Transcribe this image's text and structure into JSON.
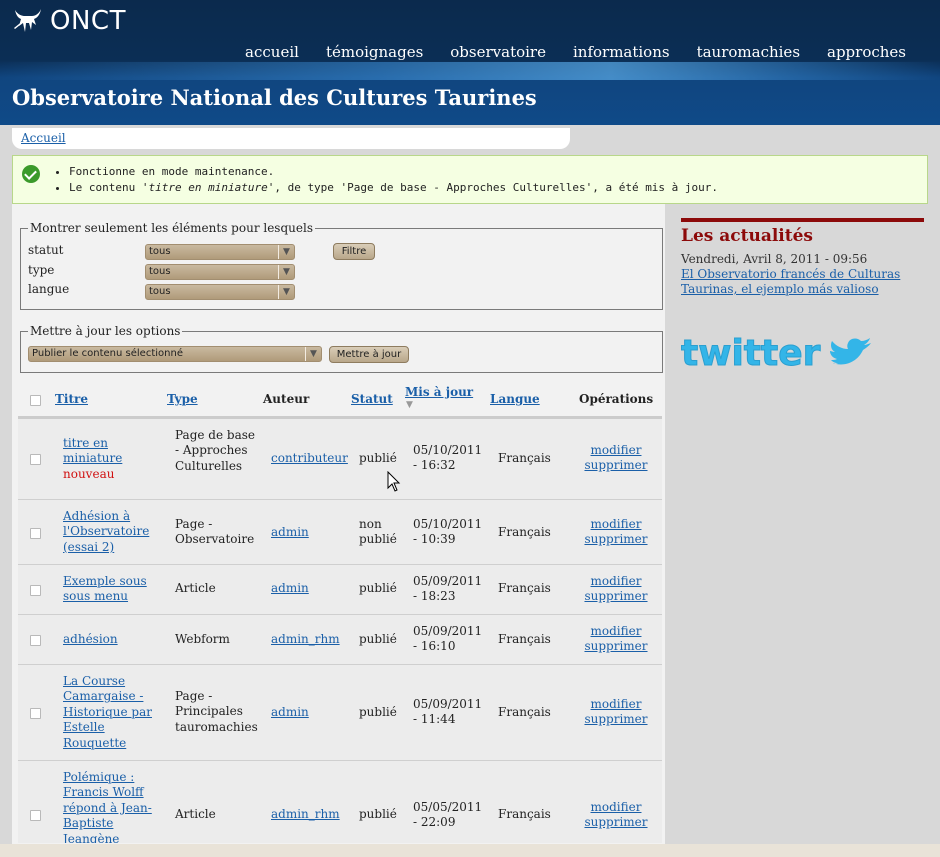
{
  "header": {
    "logo_text": "ONCT",
    "site_title": "Observatoire National des Cultures Taurines",
    "nav": [
      "accueil",
      "témoignages",
      "observatoire",
      "informations",
      "tauromachies",
      "approches"
    ]
  },
  "breadcrumb": {
    "home": "Accueil"
  },
  "messages": {
    "line1": "Fonctionne en mode maintenance.",
    "line2_pre": "Le contenu '",
    "line2_title": "titre en miniature",
    "line2_post": "', de type 'Page de base - Approches Culturelles', a été mis à jour."
  },
  "filter": {
    "legend": "Montrer seulement les éléments pour lesquels",
    "status_label": "statut",
    "type_label": "type",
    "lang_label": "langue",
    "status_value": "tous",
    "type_value": "tous",
    "lang_value": "tous",
    "button": "Filtre"
  },
  "update": {
    "legend": "Mettre à jour les options",
    "select_value": "Publier le contenu sélectionné",
    "button": "Mettre à jour"
  },
  "table": {
    "headers": {
      "title": "Titre",
      "type": "Type",
      "author": "Auteur",
      "status": "Statut",
      "updated": "Mis à jour",
      "lang": "Langue",
      "ops": "Opérations"
    },
    "rows": [
      {
        "title": "titre en miniature",
        "badge": "nouveau",
        "type": "Page de base - Approches Culturelles",
        "author": "contributeur",
        "status": "publié",
        "updated": "05/10/2011 - 16:32",
        "lang": "Français",
        "edit": "modifier",
        "delete": "supprimer"
      },
      {
        "title": "Adhésion à l'Observatoire (essai 2)",
        "badge": "",
        "type": "Page - Observatoire",
        "author": "admin",
        "status": "non publié",
        "updated": "05/10/2011 - 10:39",
        "lang": "Français",
        "edit": "modifier",
        "delete": "supprimer"
      },
      {
        "title": "Exemple sous sous menu",
        "badge": "",
        "type": "Article",
        "author": "admin",
        "status": "publié",
        "updated": "05/09/2011 - 18:23",
        "lang": "Français",
        "edit": "modifier",
        "delete": "supprimer"
      },
      {
        "title": "adhésion",
        "badge": "",
        "type": "Webform",
        "author": "admin_rhm",
        "status": "publié",
        "updated": "05/09/2011 - 16:10",
        "lang": "Français",
        "edit": "modifier",
        "delete": "supprimer"
      },
      {
        "title": "La Course Camargaise - Historique par Estelle Rouquette",
        "badge": "",
        "type": "Page - Principales tauromachies",
        "author": "admin",
        "status": "publié",
        "updated": "05/09/2011 - 11:44",
        "lang": "Français",
        "edit": "modifier",
        "delete": "supprimer"
      },
      {
        "title": "Polémique : Francis Wolff répond à Jean-Baptiste Jeangène",
        "badge": "",
        "type": "Article",
        "author": "admin_rhm",
        "status": "publié",
        "updated": "05/05/2011 - 22:09",
        "lang": "Français",
        "edit": "modifier",
        "delete": "supprimer"
      }
    ]
  },
  "sidebar": {
    "title": "Les actualités",
    "date": "Vendredi, Avril 8, 2011 - 09:56",
    "news_link": "El Observatorio francés de Culturas Taurinas, el ejemplo más valioso",
    "twitter_text": "twitter"
  },
  "colors": {
    "header_dark": "#0b2a4d",
    "header_light": "#0f4a88",
    "link": "#1a5fa8",
    "accent_red": "#8c0a0a",
    "new_badge": "#d01010",
    "twitter": "#33b5e8"
  }
}
